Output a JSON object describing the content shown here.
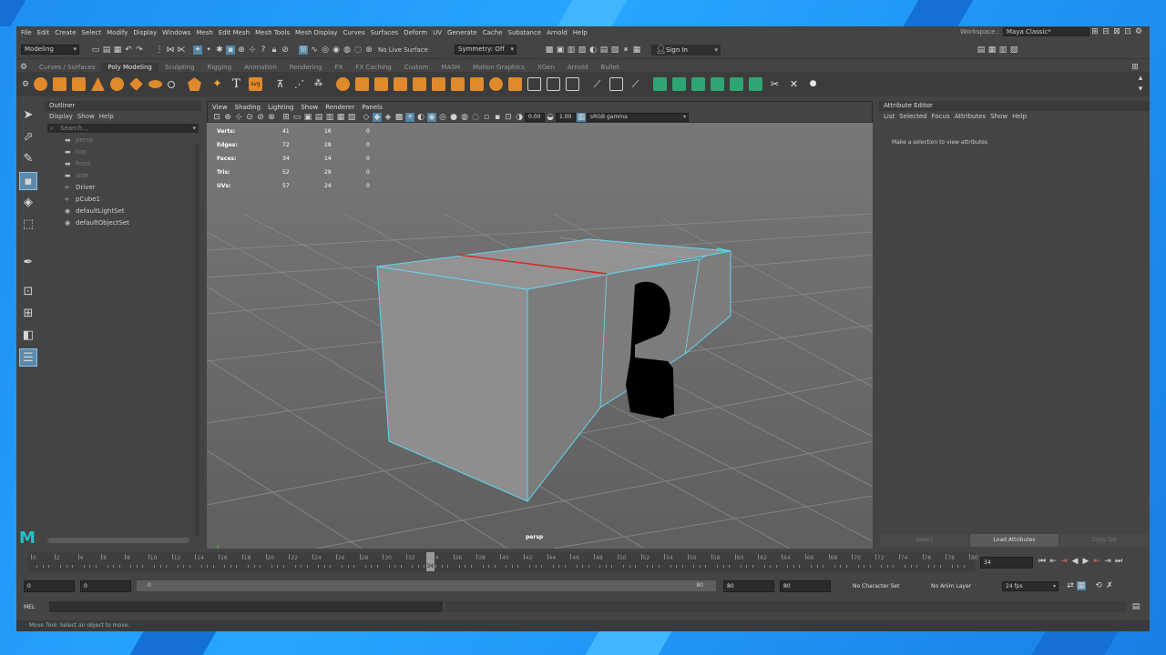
{
  "menus": [
    "File",
    "Edit",
    "Create",
    "Select",
    "Modify",
    "Display",
    "Windows",
    "Mesh",
    "Edit Mesh",
    "Mesh Tools",
    "Mesh Display",
    "Curves",
    "Surfaces",
    "Deform",
    "UV",
    "Generate",
    "Cache",
    "Substance",
    "Arnold",
    "Help"
  ],
  "workspace": {
    "label": "Workspace :",
    "value": "Maya Classic*"
  },
  "status": {
    "mode": "Modeling",
    "live_surface": "No Live Surface",
    "symmetry": "Symmetry: Off",
    "sign_in": "Sign In"
  },
  "shelf_tabs": [
    "Curves / Surfaces",
    "Poly Modeling",
    "Sculpting",
    "Rigging",
    "Animation",
    "Rendering",
    "FX",
    "FX Caching",
    "Custom",
    "MASH",
    "Motion Graphics",
    "XGen",
    "Arnold",
    "Bullet"
  ],
  "shelf_active": "Poly Modeling",
  "outliner": {
    "title": "Outliner",
    "menu": [
      "Display",
      "Show",
      "Help"
    ],
    "search_placeholder": "Search...",
    "items": [
      {
        "label": "persp",
        "icon": "camera-icon",
        "dim": true
      },
      {
        "label": "top",
        "icon": "camera-icon",
        "dim": true
      },
      {
        "label": "front",
        "icon": "camera-icon",
        "dim": true
      },
      {
        "label": "side",
        "icon": "camera-icon",
        "dim": true
      },
      {
        "label": "Driver",
        "icon": "mesh-icon",
        "dim": false
      },
      {
        "label": "pCube1",
        "icon": "mesh-icon",
        "dim": false
      },
      {
        "label": "defaultLightSet",
        "icon": "set-icon",
        "dim": false
      },
      {
        "label": "defaultObjectSet",
        "icon": "set-icon",
        "dim": false
      }
    ]
  },
  "viewport": {
    "menu": [
      "View",
      "Shading",
      "Lighting",
      "Show",
      "Renderer",
      "Panels"
    ],
    "exposure": "0.00",
    "gamma": "1.00",
    "color_space": "sRGB gamma",
    "camera_label": "persp",
    "hud": [
      {
        "k": "Verts:",
        "a": "41",
        "b": "16",
        "c": "0"
      },
      {
        "k": "Edges:",
        "a": "72",
        "b": "28",
        "c": "0"
      },
      {
        "k": "Faces:",
        "a": "34",
        "b": "14",
        "c": "0"
      },
      {
        "k": "Tris:",
        "a": "52",
        "b": "28",
        "c": "0"
      },
      {
        "k": "UVs:",
        "a": "57",
        "b": "24",
        "c": "0"
      }
    ]
  },
  "attribute_editor": {
    "title": "Attribute Editor",
    "menu": [
      "List",
      "Selected",
      "Focus",
      "Attributes",
      "Show",
      "Help"
    ],
    "message": "Make a selection to view attributes",
    "buttons": [
      "Select",
      "Load Attributes",
      "Copy Tab"
    ]
  },
  "timeline": {
    "labels": [
      "0",
      "2",
      "4",
      "6",
      "8",
      "10",
      "12",
      "14",
      "16",
      "18",
      "20",
      "22",
      "24",
      "26",
      "28",
      "30",
      "32",
      "34",
      "36",
      "38",
      "40",
      "42",
      "44",
      "46",
      "48",
      "50",
      "52",
      "54",
      "56",
      "58",
      "60",
      "62",
      "64",
      "66",
      "68",
      "70",
      "72",
      "74",
      "76",
      "78",
      "80"
    ],
    "current_frame": "34"
  },
  "range": {
    "start": "0",
    "start_inner": "0",
    "slider_start": "0",
    "slider_end": "80",
    "end_inner": "80",
    "end": "80",
    "character_set": "No Character Set",
    "anim_layer": "No Anim Layer",
    "fps": "24 fps"
  },
  "command": {
    "lang": "MEL"
  },
  "help_line": "Move Tool: Select an object to move."
}
